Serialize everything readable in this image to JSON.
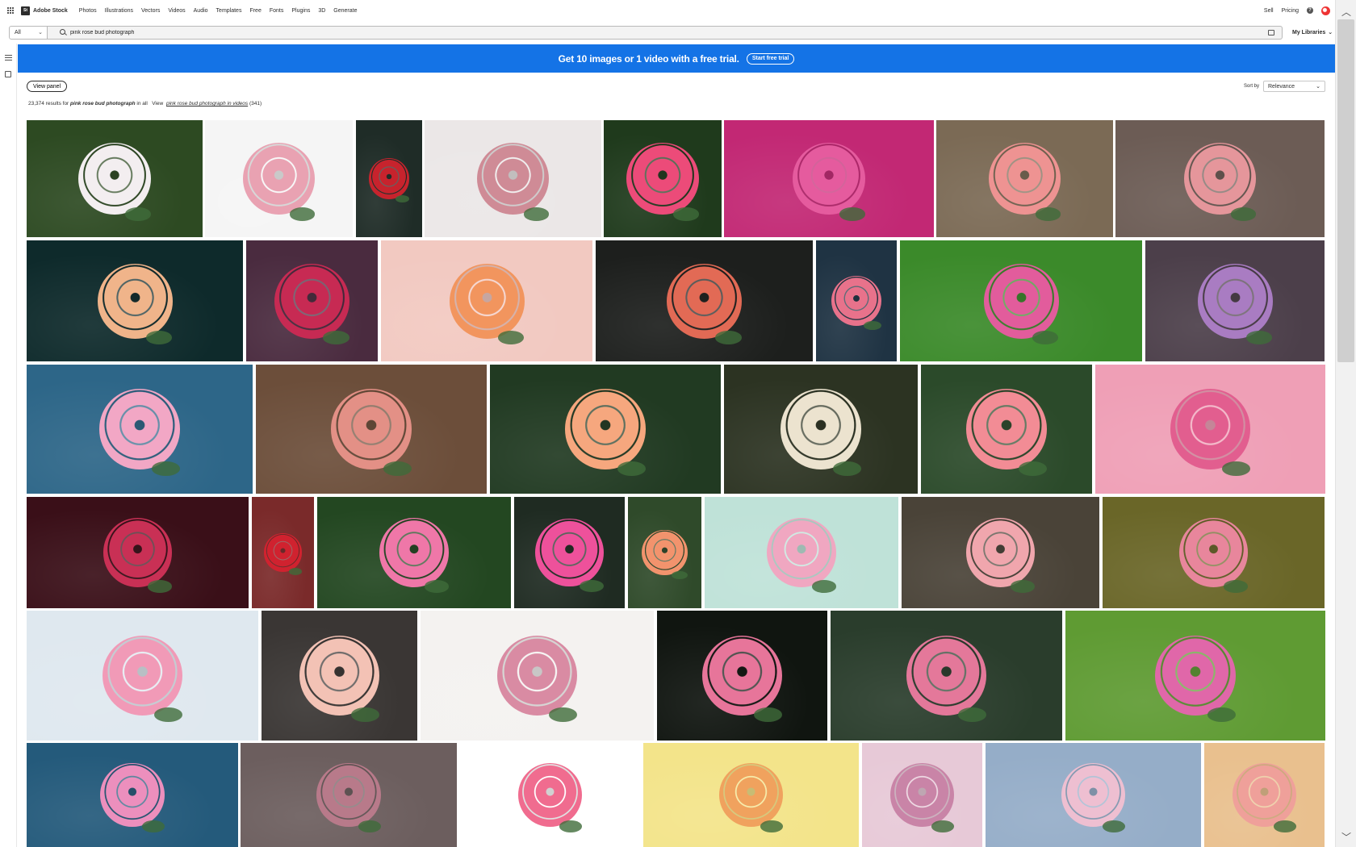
{
  "nav": {
    "logo_mark": "St",
    "logo_text": "Adobe Stock",
    "items": [
      "Photos",
      "Illustrations",
      "Vectors",
      "Videos",
      "Audio",
      "Templates",
      "Free",
      "Fonts",
      "Plugins",
      "3D",
      "Generate"
    ],
    "sell": "Sell",
    "pricing": "Pricing",
    "help": "?"
  },
  "search": {
    "scope": "All",
    "query": "pink rose bud photograph",
    "libraries": "My Libraries"
  },
  "banner": {
    "text": "Get 10 images or 1 video with a free trial.",
    "button": "Start free trial"
  },
  "controls": {
    "view_panel": "View panel",
    "sort_label": "Sort by",
    "sort_value": "Relevance"
  },
  "results": {
    "count_prefix": "23,374 results for",
    "query": "pink rose bud photograph",
    "in_all": "in all",
    "view": "View",
    "video_link": "pink rose bud photograph in videos",
    "video_count": "(341)"
  },
  "gallery": {
    "rows": [
      [
        {
          "bg": "#2d4a22",
          "rose": "#f3eef0"
        },
        {
          "bg": "#f5f5f5",
          "rose": "#e9a2b2"
        },
        {
          "bg": "#1f2c27",
          "rose": "#c7232d"
        },
        {
          "bg": "#ebe7e7",
          "rose": "#cf8b96"
        },
        {
          "bg": "#1f3a1c",
          "rose": "#ec4b79"
        },
        {
          "bg": "#c22874",
          "rose": "#e55b9e"
        },
        {
          "bg": "#7b6a55",
          "rose": "#ee9392"
        },
        {
          "bg": "#6c5c55",
          "rose": "#e5969b"
        }
      ],
      [
        {
          "bg": "#0e2a2b",
          "rose": "#f0b48a"
        },
        {
          "bg": "#4a2b3f",
          "rose": "#c72a53"
        },
        {
          "bg": "#f2c9c1",
          "rose": "#f2955e"
        },
        {
          "bg": "#1d1f1d",
          "rose": "#e26a55"
        },
        {
          "bg": "#1f3343",
          "rose": "#e8728b"
        },
        {
          "bg": "#3b8a2a",
          "rose": "#e25c9c"
        },
        {
          "bg": "#4c3f4a",
          "rose": "#a97cc2"
        }
      ],
      [
        {
          "bg": "#2d6688",
          "rose": "#f2a7c5"
        },
        {
          "bg": "#6c4e3a",
          "rose": "#e39086"
        },
        {
          "bg": "#213a22",
          "rose": "#f6a77e"
        },
        {
          "bg": "#2c3322",
          "rose": "#ece3cf"
        },
        {
          "bg": "#2b4a2a",
          "rose": "#f28c95"
        },
        {
          "bg": "#ef9fb6",
          "rose": "#e25e8f"
        }
      ],
      [
        {
          "bg": "#3a0f18",
          "rose": "#c93055"
        },
        {
          "bg": "#7a2a2a",
          "rose": "#d0222f"
        },
        {
          "bg": "#234721",
          "rose": "#ef77a8"
        },
        {
          "bg": "#1f2b22",
          "rose": "#ee519b"
        },
        {
          "bg": "#2f4a2a",
          "rose": "#f2936d"
        },
        {
          "bg": "#bfe2d8",
          "rose": "#f0a7c1"
        },
        {
          "bg": "#4a4338",
          "rose": "#f0a6ad"
        },
        {
          "bg": "#6a6628",
          "rose": "#e8869c"
        }
      ],
      [
        {
          "bg": "#dfe8ef",
          "rose": "#f19ab7"
        },
        {
          "bg": "#3a3634",
          "rose": "#f3c2b5"
        },
        {
          "bg": "#f4f2f0",
          "rose": "#d98ba3"
        },
        {
          "bg": "#101510",
          "rose": "#e7759a"
        },
        {
          "bg": "#2a3d2c",
          "rose": "#e4789a"
        },
        {
          "bg": "#5f9b33",
          "rose": "#e067a9"
        }
      ],
      [
        {
          "bg": "#245a7b",
          "rose": "#ec8fbd"
        },
        {
          "bg": "#6c5e5e",
          "rose": "#b87a8a"
        },
        {
          "bg": "#ffffff",
          "rose": "#f06c8f"
        },
        {
          "bg": "#f3e48a",
          "rose": "#f0a25e"
        },
        {
          "bg": "#e7c9d7",
          "rose": "#c984a7"
        },
        {
          "bg": "#95adc8",
          "rose": "#eebfd1"
        },
        {
          "bg": "#e9c08e",
          "rose": "#efa09a"
        }
      ]
    ]
  }
}
